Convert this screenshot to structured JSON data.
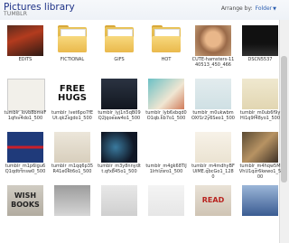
{
  "header": {
    "title": "Pictures library",
    "subtitle": "TUMBLR",
    "arrange_label": "Arrange by:",
    "arrange_value": "Folder"
  },
  "items": [
    {
      "label": "EDITS",
      "kind": "folder"
    },
    {
      "label": "FICTIONAL",
      "kind": "folder"
    },
    {
      "label": "GIFS",
      "kind": "folder"
    },
    {
      "label": "HOT",
      "kind": "folder"
    },
    {
      "label": "CUTE-hamsters-1140513_450_466",
      "kind": "image"
    },
    {
      "label": "DSCN5537",
      "kind": "image"
    },
    {
      "label": "tumblr_lovb8bmeF1qfsv4do1_500",
      "kind": "image"
    },
    {
      "label": "tumblr_lvet6po7fEUt.qk2sgdo1_500",
      "kind": "image"
    },
    {
      "label": "tumblr_lyj1n5qB09Q2jqoeaw4o1_500",
      "kind": "image"
    },
    {
      "label": "tumblr_lyb6xbqd0O1qb.kb7o1_500",
      "kind": "image"
    },
    {
      "label": "tumblr_m0ukwbmOXf1r2y6Seo1_500",
      "kind": "image"
    },
    {
      "label": "tumblr_m0ub6f9yHi1q9f48yo1_500",
      "kind": "image"
    },
    {
      "label": "tumblr_m1p6lgu6Q1qdtrtnsw0_500",
      "kind": "image"
    },
    {
      "label": "tumblr_m1qq6p35R41e0Rt6o1_500",
      "kind": "image"
    },
    {
      "label": "tumblr_m3y8nnydtt.qfx845o1_500",
      "kind": "image"
    },
    {
      "label": "tumblr_m4gk68TiJ1lrhlzsro1_500",
      "kind": "image"
    },
    {
      "label": "tumblr_m4mdhyBFUiME.qbcGo1_1280",
      "kind": "image"
    },
    {
      "label": "tumblr_m4hqw5MVhU1qzr6kewo1_500",
      "kind": "image"
    },
    {
      "label": "",
      "kind": "image",
      "text": [
        "WISH",
        "BOOKS"
      ]
    },
    {
      "label": "",
      "kind": "image"
    },
    {
      "label": "",
      "kind": "image"
    },
    {
      "label": "",
      "kind": "image"
    },
    {
      "label": "",
      "kind": "image",
      "text": [
        "READ"
      ]
    },
    {
      "label": "",
      "kind": "image"
    }
  ],
  "thumb_text": {
    "free_hugs": [
      "FREE",
      "HUGS"
    ]
  }
}
